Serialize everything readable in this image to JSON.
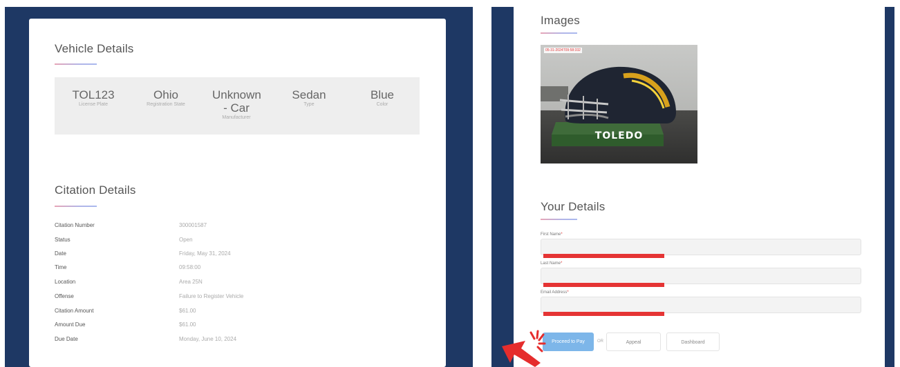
{
  "colors": {
    "navy": "#1e3864",
    "accent_red": "#e53434",
    "button_blue": "#7db6e9"
  },
  "vehicle": {
    "title": "Vehicle Details",
    "tiles": [
      {
        "value": "TOL123",
        "label": "License Plate"
      },
      {
        "value": "Ohio",
        "label": "Registration State"
      },
      {
        "value": "Unknown - Car",
        "label": "Manufacturer"
      },
      {
        "value": "Sedan",
        "label": "Type"
      },
      {
        "value": "Blue",
        "label": "Color"
      }
    ]
  },
  "citation": {
    "title": "Citation Details",
    "rows": [
      {
        "key": "Citation Number",
        "value": "300001587"
      },
      {
        "key": "Status",
        "value": "Open"
      },
      {
        "key": "Date",
        "value": "Friday, May 31, 2024"
      },
      {
        "key": "Time",
        "value": "09:58:00"
      },
      {
        "key": "Location",
        "value": "Area 25N"
      },
      {
        "key": "Offense",
        "value": "Failure to Register Vehicle"
      },
      {
        "key": "Citation Amount",
        "value": "$61.00"
      },
      {
        "key": "Amount Due",
        "value": "$61.00"
      },
      {
        "key": "Due Date",
        "value": "Monday, June 10, 2024"
      }
    ]
  },
  "images": {
    "title": "Images",
    "photo": {
      "timestamp": "05-31-2024T09:58:332",
      "sign_text": "TOLEDO",
      "icon": "helmet-photo"
    }
  },
  "your_details": {
    "title": "Your Details",
    "fields": [
      {
        "label": "First Name",
        "required": "*"
      },
      {
        "label": "Last Name",
        "required": "*"
      },
      {
        "label": "Email Address",
        "required": "*"
      }
    ]
  },
  "actions": {
    "pay": "Proceed to Pay",
    "or": "OR",
    "appeal": "Appeal",
    "dashboard": "Dashboard"
  }
}
